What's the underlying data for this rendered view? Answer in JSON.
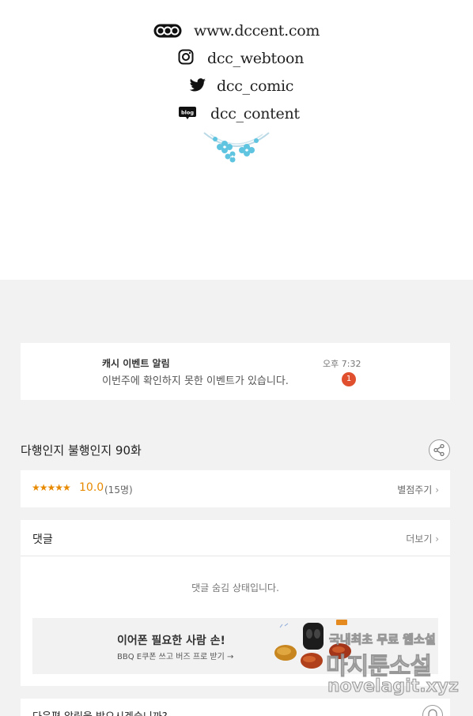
{
  "credits": {
    "website": "www.dccent.com",
    "instagram": "dcc_webtoon",
    "twitter": "dcc_comic",
    "blog": "dcc_content",
    "icons": [
      "dcc-logo-icon",
      "instagram-icon",
      "twitter-icon",
      "blog-icon"
    ]
  },
  "notification": {
    "title": "캐시 이벤트 알림",
    "message": "이번주에 확인하지 못한 이벤트가 있습니다.",
    "time": "오후 7:32",
    "badge": "1"
  },
  "episode": {
    "title": "다행인지 불행인지 90화"
  },
  "rating": {
    "stars": "★★★★★",
    "score": "10.0",
    "count": "(15명)",
    "rate_label": "별점주기",
    "rate_arrow": "›"
  },
  "comments": {
    "header": "댓글",
    "more_label": "더보기",
    "more_arrow": "›",
    "hidden_text": "댓글 숨김 상태입니다."
  },
  "ad": {
    "title": "이어폰 필요한 사람 손!",
    "subtitle": "BBQ E쿠폰 쓰고 버즈 프로 받기 →"
  },
  "next_alert": {
    "text": "다음편 알림을 받으시겠습니까?"
  },
  "watermark": {
    "line1": "국내최초 무료 웹소설",
    "line2": "마지툰소설",
    "line3": "novelagit.xyz"
  },
  "colors": {
    "accent": "#e88a00",
    "badge": "#e0502f",
    "background": "#f2f2f2"
  }
}
